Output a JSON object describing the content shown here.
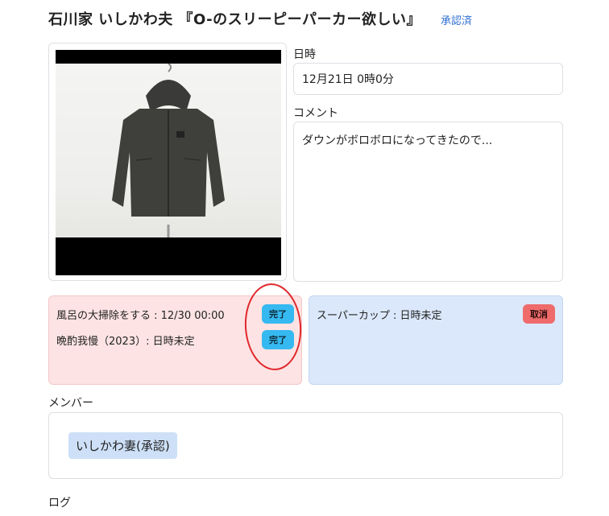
{
  "header": {
    "title": "石川家 いしかわ夫 『O-のスリーピーパーカー欲しい』",
    "approval_status": "承認済"
  },
  "photo": {
    "description_icon": "jacket-photo"
  },
  "datetime": {
    "label": "日時",
    "value": "12月21日 0時0分"
  },
  "comment": {
    "label": "コメント",
    "value": "ダウンがボロボロになってきたので..."
  },
  "tasks_pink": [
    {
      "text": "風呂の大掃除をする : 12/30 00:00",
      "badge": "完了"
    },
    {
      "text": "晩酌我慢（2023）: 日時未定",
      "badge": "完了"
    }
  ],
  "tasks_blue": [
    {
      "text": "スーパーカップ : 日時未定",
      "badge": "取消"
    }
  ],
  "members": {
    "label": "メンバー",
    "items": [
      "いしかわ妻(承認)"
    ]
  },
  "log": {
    "label": "ログ"
  },
  "colors": {
    "accent": "#2f6fd1",
    "done": "#35b9f0",
    "cancel": "#ef6b6b",
    "pink_card": "#fde3e3",
    "blue_card": "#dbe8fb"
  }
}
